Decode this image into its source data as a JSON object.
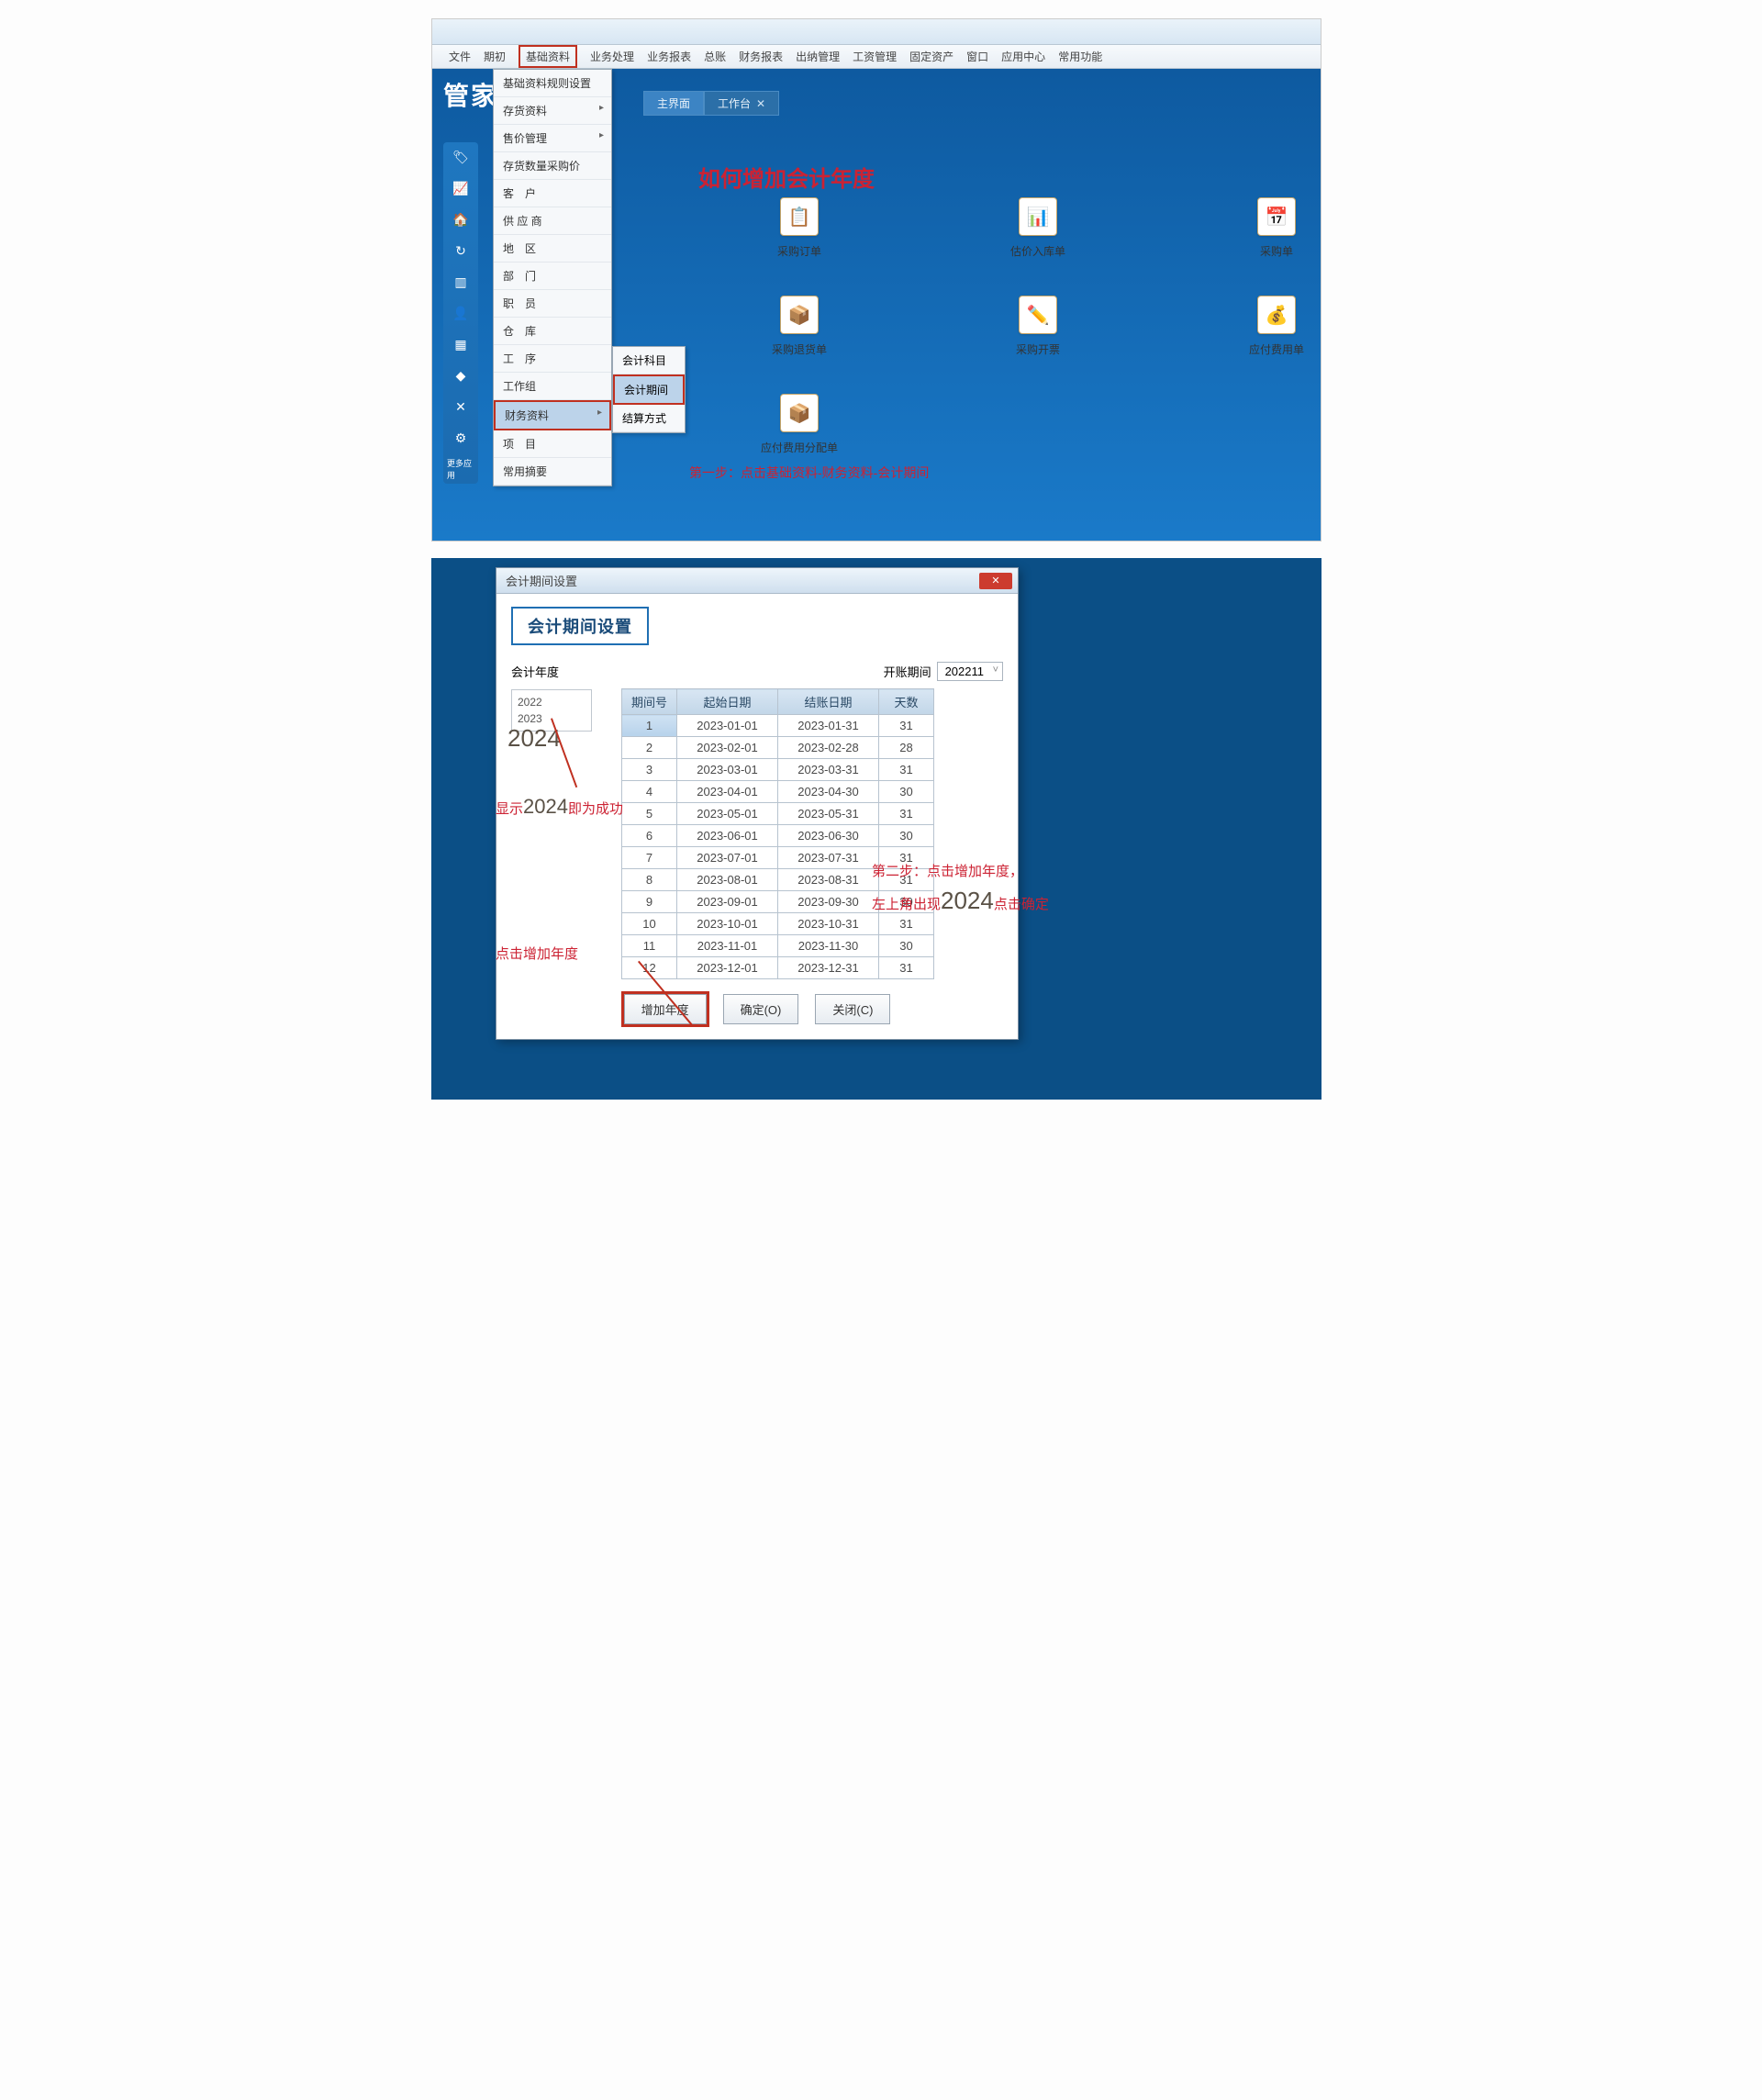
{
  "top_menubar": [
    "文件",
    "期初",
    "基础资料",
    "业务处理",
    "业务报表",
    "总账",
    "财务报表",
    "出纳管理",
    "工资管理",
    "固定资产",
    "窗口",
    "应用中心",
    "常用功能"
  ],
  "top_menubar_hi_index": 2,
  "logo": "管家婆",
  "tabs": [
    {
      "label": "主界面",
      "active": true
    },
    {
      "label": "工作台",
      "active": false
    }
  ],
  "dropdown": [
    {
      "label": "基础资料规则设置",
      "arrow": false
    },
    {
      "label": "存货资料",
      "arrow": true
    },
    {
      "label": "售价管理",
      "arrow": true
    },
    {
      "label": "存货数量采购价",
      "arrow": false
    },
    {
      "label": "客　户",
      "arrow": false
    },
    {
      "label": "供 应 商",
      "arrow": false
    },
    {
      "label": "地　区",
      "arrow": false
    },
    {
      "label": "部　门",
      "arrow": false
    },
    {
      "label": "职　员",
      "arrow": false
    },
    {
      "label": "仓　库",
      "arrow": false
    },
    {
      "label": "工　序",
      "arrow": false
    },
    {
      "label": "工作组",
      "arrow": false
    },
    {
      "label": "财务资料",
      "arrow": true,
      "hi": true
    },
    {
      "label": "项　目",
      "arrow": false
    },
    {
      "label": "常用摘要",
      "arrow": false
    }
  ],
  "submenu": [
    {
      "label": "会计科目"
    },
    {
      "label": "会计期间",
      "hi": true
    },
    {
      "label": "结算方式"
    }
  ],
  "sidebar_more": "更多应用",
  "title_red": "如何增加会计年度",
  "tiles": [
    {
      "label": "采购订单",
      "glyph": "📋"
    },
    {
      "label": "估价入库单",
      "glyph": "📊"
    },
    {
      "label": "采购单",
      "glyph": "📅"
    },
    {
      "label": "采购退货单",
      "glyph": "📦"
    },
    {
      "label": "采购开票",
      "glyph": "✏️"
    },
    {
      "label": "应付费用单",
      "glyph": "💰"
    },
    {
      "label": "应付费用分配单",
      "glyph": "📦"
    }
  ],
  "step1": "第一步：点击基础资料-财务资料-会计期间",
  "dlg_title": "会计期间设置",
  "dlg_heading": "会计期间设置",
  "label_year": "会计年度",
  "label_openperiod": "开账期间",
  "openperiod_value": "202211",
  "years_list": [
    "2022",
    "2023"
  ],
  "year_big": "2024",
  "grid_headers": [
    "期间号",
    "起始日期",
    "结账日期",
    "天数"
  ],
  "grid_rows": [
    [
      "1",
      "2023-01-01",
      "2023-01-31",
      "31"
    ],
    [
      "2",
      "2023-02-01",
      "2023-02-28",
      "28"
    ],
    [
      "3",
      "2023-03-01",
      "2023-03-31",
      "31"
    ],
    [
      "4",
      "2023-04-01",
      "2023-04-30",
      "30"
    ],
    [
      "5",
      "2023-05-01",
      "2023-05-31",
      "31"
    ],
    [
      "6",
      "2023-06-01",
      "2023-06-30",
      "30"
    ],
    [
      "7",
      "2023-07-01",
      "2023-07-31",
      "31"
    ],
    [
      "8",
      "2023-08-01",
      "2023-08-31",
      "31"
    ],
    [
      "9",
      "2023-09-01",
      "2023-09-30",
      "30"
    ],
    [
      "10",
      "2023-10-01",
      "2023-10-31",
      "31"
    ],
    [
      "11",
      "2023-11-01",
      "2023-11-30",
      "30"
    ],
    [
      "12",
      "2023-12-01",
      "2023-12-31",
      "31"
    ]
  ],
  "buttons": {
    "add": "增加年度",
    "ok": "确定(O)",
    "close": "关闭(C)"
  },
  "ann": {
    "show2024a": "显示",
    "show2024b": "2024",
    "show2024c": "即为成功",
    "step2a": "第二步：点击增加年度，",
    "step2b": "左上角出现",
    "step2c": "2024",
    "step2d": "点击确定",
    "click_add": "点击增加年度"
  }
}
